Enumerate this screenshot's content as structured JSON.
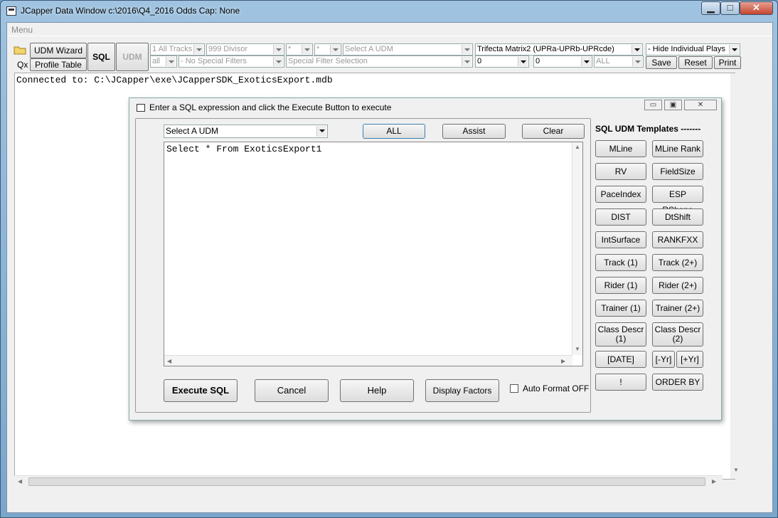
{
  "window": {
    "title": "JCapper Data Window c:\\2016\\Q4_2016 Odds Cap: None",
    "min_glyph": "▁",
    "max_glyph": "□",
    "close_glyph": "✕",
    "menu": "Menu"
  },
  "toolbar": {
    "udm_wizard": "UDM Wizard",
    "qx": "Qx",
    "profile_table": "Profile Table",
    "sql": "SQL",
    "udm": "UDM",
    "tracks": "1 All Tracks",
    "divisor": "999 Divisor",
    "star1": "*",
    "star2": "*",
    "select_udm": "Select A UDM",
    "all": "all",
    "no_special_filters": "- No Special Filters",
    "special_filter_selection": "Special Filter Selection",
    "trifecta": "Trifecta Matrix2 (UPRa-UPRb-UPRcde)",
    "zero1": "0",
    "zero2": "0",
    "ALL": "ALL",
    "hide_plays": "- Hide Individual Plays",
    "save": "Save",
    "reset": "Reset",
    "print": "Print"
  },
  "console": {
    "text": "Connected to: C:\\JCapper\\exe\\JCapperSDK_ExoticsExport.mdb"
  },
  "dialog": {
    "title": "Enter a SQL expression and click the Execute Button to execute",
    "min_glyph": "▭",
    "max_glyph": "▣",
    "close_glyph": "✕",
    "udm_select": "Select A UDM",
    "all_button": "ALL",
    "assist_button": "Assist",
    "clear_button": "Clear",
    "sql_text": "Select * From ExoticsExport1",
    "execute_button": "Execute SQL",
    "cancel_button": "Cancel",
    "help_button": "Help",
    "display_factors_button": "Display Factors",
    "auto_format_label": "Auto Format OFF",
    "auto_format_checked": false,
    "templates_title": "SQL UDM Templates -------",
    "templates": {
      "mline": "MLine",
      "mline_rank": "MLine Rank",
      "rv": "RV",
      "fieldsize": "FieldSize",
      "paceindex": "PaceIndex",
      "esp_rshape": "ESP RShape",
      "dist": "DIST",
      "dtshift": "DtShift",
      "intsurface": "IntSurface",
      "rankfxx": "RANKFXX",
      "track1": "Track (1)",
      "track2": "Track (2+)",
      "rider1": "Rider (1)",
      "rider2": "Rider (2+)",
      "trainer1": "Trainer (1)",
      "trainer2": "Trainer (2+)",
      "class_descr1_a": "Class Descr",
      "class_descr1_b": "(1)",
      "class_descr2_a": "Class Descr",
      "class_descr2_b": "(2)",
      "date": "[DATE]",
      "minus_yr": "[-Yr]",
      "plus_yr": "[+Yr]",
      "bang": "!",
      "order_by": "ORDER BY"
    }
  }
}
